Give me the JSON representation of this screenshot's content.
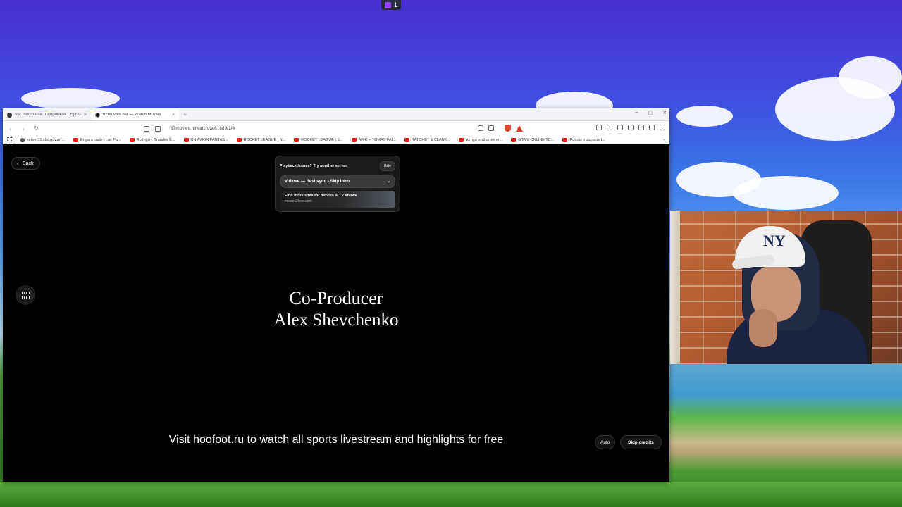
{
  "twitch": {
    "icon": "twitch-icon",
    "count": "1"
  },
  "tabs": [
    {
      "title": "Ver Indomable: Temporada 1 Episod",
      "close": "×"
    },
    {
      "title": "67movies.net — Watch Movies",
      "close": "×"
    }
  ],
  "new_tab": "+",
  "window_controls": {
    "minimize": "–",
    "maximize": "▢",
    "close": "✕"
  },
  "nav": {
    "back": "‹",
    "forward": "›",
    "reload": "↻",
    "url": "67movies.nl/watch/tv/61889/1/4"
  },
  "bookmarks": [
    {
      "label": "server35.sbc.gov.ar/...",
      "icon": "globe-icon"
    },
    {
      "label": "Enganchado - Las Pa...",
      "icon": "youtube-icon"
    },
    {
      "label": "Rodrigo - Grandes É...",
      "icon": "youtube-icon"
    },
    {
      "label": "UN AVION FANTAS...",
      "icon": "youtube-icon"
    },
    {
      "label": "ROCKET LEAGUE | N...",
      "icon": "youtube-icon"
    },
    {
      "label": "ROCKET LEAGUE | S...",
      "icon": "youtube-icon"
    },
    {
      "label": "AR-K + TOMAS FAI...",
      "icon": "youtube-icon"
    },
    {
      "label": "RATCHET & CLANK...",
      "icon": "youtube-icon"
    },
    {
      "label": "Abrigo ocultar en er...",
      "icon": "youtube-icon"
    },
    {
      "label": "GTA V ONLINE TC...",
      "icon": "youtube-icon"
    },
    {
      "label": "Robots o zapatos t...",
      "icon": "youtube-icon"
    }
  ],
  "bookmarks_more": "»",
  "player": {
    "back_label": "Back",
    "server_panel": {
      "title": "Playback issues? Try another server.",
      "hide_label": "Hide",
      "selected_server": "Vidlove — Best sync • Skip Intro",
      "promo_title": "Find more sites for movies & TV shows",
      "promo_url": "movies2love.com"
    },
    "credit_role": "Co-Producer",
    "credit_name": "Alex Shevchenko",
    "subtitle": "Visit hoofoot.ru to watch all sports livestream and highlights for free",
    "quality_label": "Auto",
    "skip_credits_label": "Skip credits"
  },
  "webcam": {
    "cap_logo": "NY"
  }
}
